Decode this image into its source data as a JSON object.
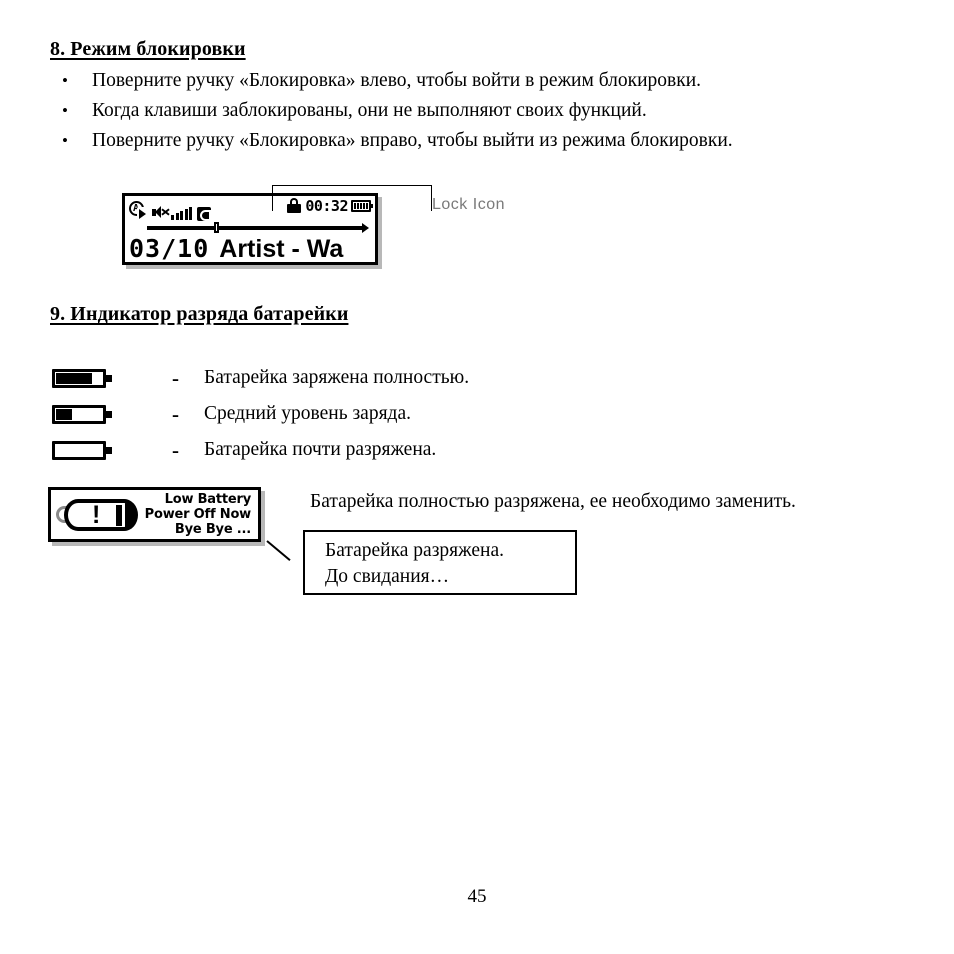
{
  "sections": {
    "lock_mode": {
      "heading": "8. Режим блокировки",
      "bullets": [
        "Поверните ручку «Блокировка» влево, чтобы войти в режим блокировки.",
        "Когда клавиши заблокированы, они не выполняют своих функций.",
        "Поверните ручку «Блокировка» вправо, чтобы выйти из режима блокировки."
      ],
      "bullet_marker": "•",
      "callout_label": "Lock Icon"
    },
    "battery_indicator": {
      "heading": "9. Индикатор разряда батарейки",
      "legend": [
        {
          "dash": "-",
          "text": "Батарейка заряжена полностью.",
          "level_percent": 72
        },
        {
          "dash": "-",
          "text": "Средний уровень заряда.",
          "level_percent": 33
        },
        {
          "dash": "-",
          "text": "Батарейка почти разряжена.",
          "level_percent": 0
        }
      ],
      "low_battery_sentence": "Батарейка полностью разряжена, ее необходимо заменить.",
      "translation_box": {
        "line1": "Батарейка разряжена.",
        "line2": "До свидания…"
      }
    }
  },
  "player_lcd": {
    "icons": {
      "repeat_a": "A",
      "repeat_play_icon": "play-arrow-icon",
      "speaker_mute_icon": "speaker-mute-icon",
      "signal_bars_icon": "signal-bars-icon",
      "mode_badge_icon": "eq-mode-badge-icon",
      "lock_icon": "lock-icon",
      "battery_icon": "battery-icon"
    },
    "time": "00:32",
    "progress_percent": 30,
    "track_number": "03/10",
    "track_title": "Artist - Wa"
  },
  "low_battery_lcd": {
    "warning_icon": "battery-warning-icon",
    "exclamation": "!",
    "lines": [
      "Low Battery",
      "Power Off Now",
      "Bye Bye ..."
    ]
  },
  "footer": {
    "page_number": "45"
  }
}
